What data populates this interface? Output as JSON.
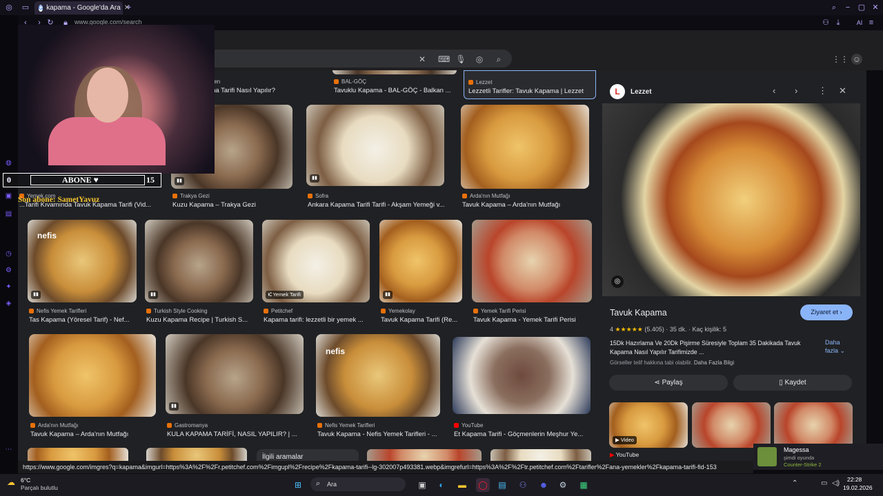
{
  "tab": {
    "title": "kapama - Google'da Ara",
    "new_tab": "+"
  },
  "address": {
    "url": "www.google.com/search"
  },
  "toolbar_right": {
    "ai_label": "AI"
  },
  "grid": {
    "row0": [
      {
        "source": "Lütfen",
        "caption": "...pama Tarifi Nasıl Yapılır?"
      },
      {
        "source": "BAL-GÖÇ",
        "caption": "Tavuklu Kapama - BAL-GÖÇ - Balkan ..."
      },
      {
        "source": "Lezzet",
        "caption": "Lezzetli Tarifler: Tavuk Kapama | Lezzet"
      }
    ],
    "row1": [
      {
        "source": "Yemek.com",
        "caption": "...Tarifi Kıvamında Tavuk Kapama Tarifi (Vid..."
      },
      {
        "source": "Trakya Gezi",
        "caption": "Kuzu Kapama – Trakya Gezi"
      },
      {
        "source": "Sofra",
        "caption": "Ankara Kapama Tarifi Tarifi - Akşam Yemeği v..."
      },
      {
        "source": "Arda'nın Mutfağı",
        "caption": "Tavuk Kapama – Arda'nın Mutfağı"
      }
    ],
    "row2": [
      {
        "source": "Nefis Yemek Tarifleri",
        "caption": "Tas Kapama (Yöresel Tarif) - Nef...",
        "overlay": "nefis"
      },
      {
        "source": "Turkish Style Cooking",
        "caption": "Kuzu Kapama Recipe | Turkish S..."
      },
      {
        "source": "Petitchef",
        "caption": "Kapama tarifi: lezzetli bir yemek ...",
        "badge": "Yemek Tarifi"
      },
      {
        "source": "Yemekolay",
        "caption": "Tavuk Kapama Tarifi (Re..."
      },
      {
        "source": "Yemek Tarifi Perisi",
        "caption": "Tavuk Kapama - Yemek Tarifi Perisi"
      }
    ],
    "row3": [
      {
        "source": "Arda'nın Mutfağı",
        "caption": "Tavuk Kapama – Arda'nın Mutfağı"
      },
      {
        "source": "Gastromanya",
        "caption": "KULA KAPAMA TARİFİ, NASIL YAPILIR? | ..."
      },
      {
        "source": "Nefis Yemek Tarifleri",
        "caption": "Tavuk Kapama - Nefis Yemek Tarifleri - ...",
        "overlay": "nefis"
      },
      {
        "source": "YouTube",
        "caption": "Et Kapama Tarifi - Göçmenlerin Meşhur Ye..."
      }
    ],
    "related": "İlgili aramalar"
  },
  "panel": {
    "source": "Lezzet",
    "title": "Tavuk Kapama",
    "visit": "Ziyaret et",
    "rating": "4",
    "stars": "★★★★★",
    "reviews": "(5.405)",
    "time": "35 dk.",
    "servings": "Kaç kişilik: 5",
    "desc": "15Dk Hazırlama Ve 20Dk Pişirme Süresiyle Toplam 35 Dakikada Tavuk Kapama Nasıl Yapılır Tarifimizde ...",
    "more": "Daha fazla",
    "copyright": "Görseller telif hakkına tabi olabilir.",
    "learn_more": "Daha Fazla Bilgi",
    "share": "Paylaş",
    "save": "Kaydet",
    "video_label": "Video",
    "youtube": "YouTube"
  },
  "status_url": "https://www.google.com/imgres?q=kapama&imgurl=https%3A%2F%2Fr.petitchef.com%2Fimgupl%2Frecipe%2Fkapama-tarifi--lg-302007p493381.webp&imgrefurl=https%3A%2F%2Ftr.petitchef.com%2Ftarifler%2Fana-yemekler%2Fkapama-tarifi-fid-153",
  "overlay": {
    "sub_left": "0",
    "sub_label": "ABONE ♥",
    "sub_right": "15",
    "last_sub": "Son abone: SametYavuz"
  },
  "notification": {
    "name": "Magessa",
    "status": "şimdi oyunda",
    "game": "Counter-Strike 2"
  },
  "taskbar": {
    "temp": "6°C",
    "weather": "Parçalı bulutlu",
    "search": "Ara",
    "time": "22:28",
    "date": "19.02.2026"
  }
}
